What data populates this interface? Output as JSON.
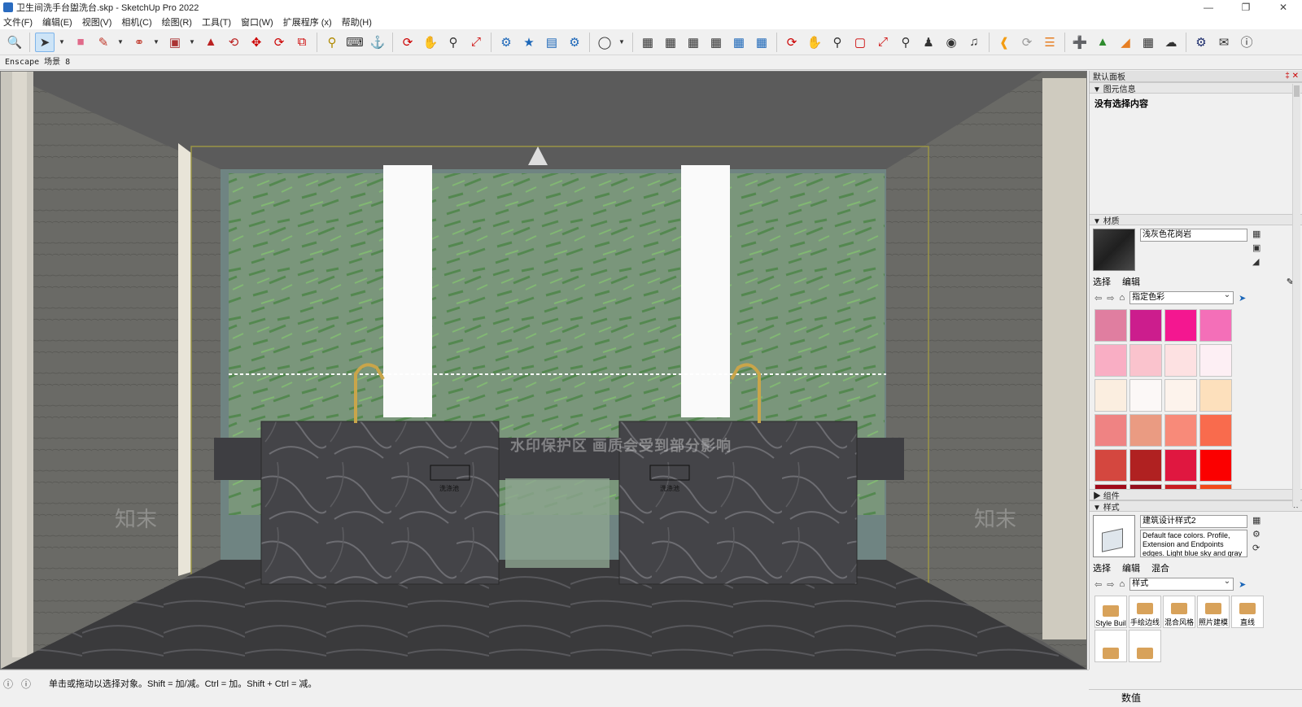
{
  "window": {
    "title": "卫生间洗手台盥洗台.skp - SketchUp Pro 2022"
  },
  "menu": [
    "文件(F)",
    "编辑(E)",
    "视图(V)",
    "相机(C)",
    "绘图(R)",
    "工具(T)",
    "窗口(W)",
    "扩展程序 (x)",
    "帮助(H)"
  ],
  "scene_tab": "Enscape 场景 8",
  "viewport": {
    "watermark": "水印保护区 画质会受到部分影响",
    "label_left": "洗涤池",
    "label_right": "洗涤池",
    "brand_mark": "知末"
  },
  "panel": {
    "title": "默认面板",
    "entity_info": {
      "header": "图元信息",
      "body": "没有选择内容"
    },
    "materials": {
      "header": "材质",
      "current_name": "浅灰色花岗岩",
      "tabs": [
        "选择",
        "编辑"
      ],
      "library": "指定色彩",
      "swatch_colors": [
        "#e07ea0",
        "#cc1d8d",
        "#f41790",
        "#f46fb8",
        "#f9aec4",
        "#fac3cd",
        "#fde1e2",
        "#fdeff4",
        "#fbeee0",
        "#fcf8f7",
        "#fdf3ec",
        "#fde0bc",
        "#ef8383",
        "#ea9b82",
        "#f88a79",
        "#f96b4d",
        "#d4473f",
        "#b02121",
        "#e01740",
        "#fb0000",
        "#a00a1a",
        "#95101e",
        "#c81d22",
        "#f24a1a"
      ]
    },
    "components": {
      "header": "组件"
    },
    "styles": {
      "header": "样式",
      "current_name": "建筑设计样式2",
      "description": "Default face colors. Profile, Extension and Endpoints edges. Light blue sky and gray",
      "tabs": [
        "选择",
        "编辑",
        "混合"
      ],
      "library": "样式",
      "items": [
        "Style Buil",
        "手绘边线",
        "混合风格",
        "照片建模",
        "直线",
        "",
        ""
      ]
    }
  },
  "status": {
    "message": "单击或拖动以选择对象。Shift = 加/减。Ctrl = 加。Shift + Ctrl = 减。",
    "value_label": "数值"
  }
}
